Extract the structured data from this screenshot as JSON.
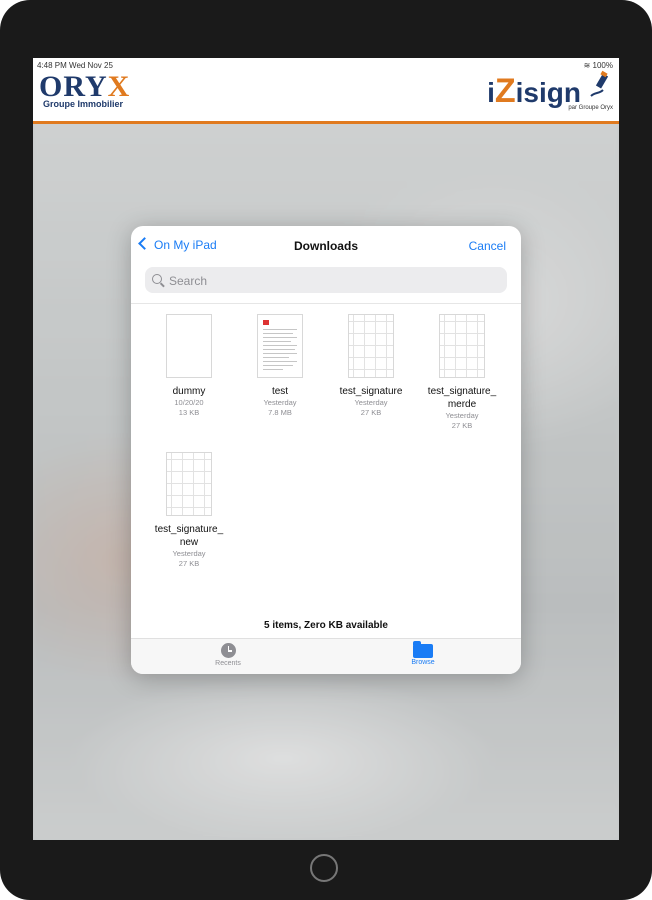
{
  "statusbar": {
    "time": "4:48 PM",
    "date": "Wed Nov 25",
    "battery": "100%"
  },
  "header": {
    "oryx_main": "ORY",
    "oryx_x": "X",
    "oryx_sub": "Groupe Immobilier",
    "izisign_i": "i",
    "izisign_z": "Z",
    "izisign_rest": "isign",
    "izisign_sub": "par Groupe Oryx"
  },
  "dialog": {
    "back_label": "On My iPad",
    "title": "Downloads",
    "cancel_label": "Cancel",
    "search_placeholder": "Search",
    "footer": "5 items, Zero KB available",
    "files": [
      {
        "name": "dummy",
        "date": "10/20/20",
        "size": "13 KB"
      },
      {
        "name": "test",
        "date": "Yesterday",
        "size": "7.8 MB"
      },
      {
        "name": "test_signature",
        "date": "Yesterday",
        "size": "27 KB"
      },
      {
        "name_line1": "test_signature_",
        "name_line2": "merde",
        "date": "Yesterday",
        "size": "27 KB"
      },
      {
        "name_line1": "test_signature_",
        "name_line2": "new",
        "date": "Yesterday",
        "size": "27 KB"
      }
    ],
    "tabs": [
      {
        "label": "Recents",
        "icon": "clock-icon"
      },
      {
        "label": "Browse",
        "icon": "folder-icon"
      }
    ]
  },
  "colors": {
    "accent": "#1a7cf5",
    "brand_blue": "#1f3a6b",
    "brand_orange": "#e07a1f"
  }
}
